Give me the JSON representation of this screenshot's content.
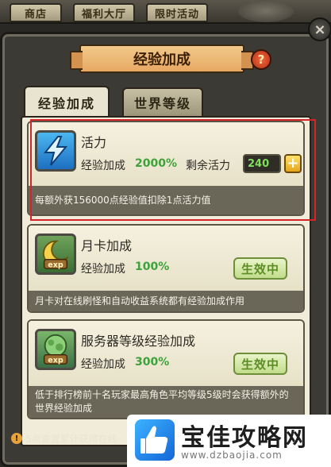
{
  "top_tabs": [
    "商店",
    "福利大厅",
    "限时活动"
  ],
  "panel": {
    "title": "经验加成",
    "help_icon": "?",
    "close_icon": "×"
  },
  "sub_tabs": [
    {
      "label": "经验加成",
      "active": true
    },
    {
      "label": "世界等级",
      "active": false
    }
  ],
  "cards": [
    {
      "icon": "energy-bolt-icon",
      "title": "活力",
      "exp_label": "经验加成",
      "exp_value": "2000%",
      "remain_label": "剩余活力",
      "remain_value": "240",
      "add_label": "+",
      "description": "每额外获156000点经验值扣除1点活力值"
    },
    {
      "icon": "moon-exp-icon",
      "title": "月卡加成",
      "exp_label": "经验加成",
      "exp_value": "100%",
      "status": "生效中",
      "description": "月卡对在线刷怪和自动收益系统都有经验加成作用"
    },
    {
      "icon": "server-exp-icon",
      "title": "服务器等级经验加成",
      "exp_label": "经验加成",
      "exp_value": "300%",
      "status": "生效中",
      "description": "低于排行榜前十名玩家最高角色平均等级5级时会获得额外的世界经验加成"
    }
  ],
  "footer": {
    "text": "5点重置累计获得在线"
  },
  "watermark": {
    "name": "宝佳攻略网",
    "url": "www.dzbaojia.com"
  },
  "colors": {
    "accent_green": "#3fa13b",
    "highlight_red": "#d4242a",
    "title_plaque": "#e7a862"
  }
}
